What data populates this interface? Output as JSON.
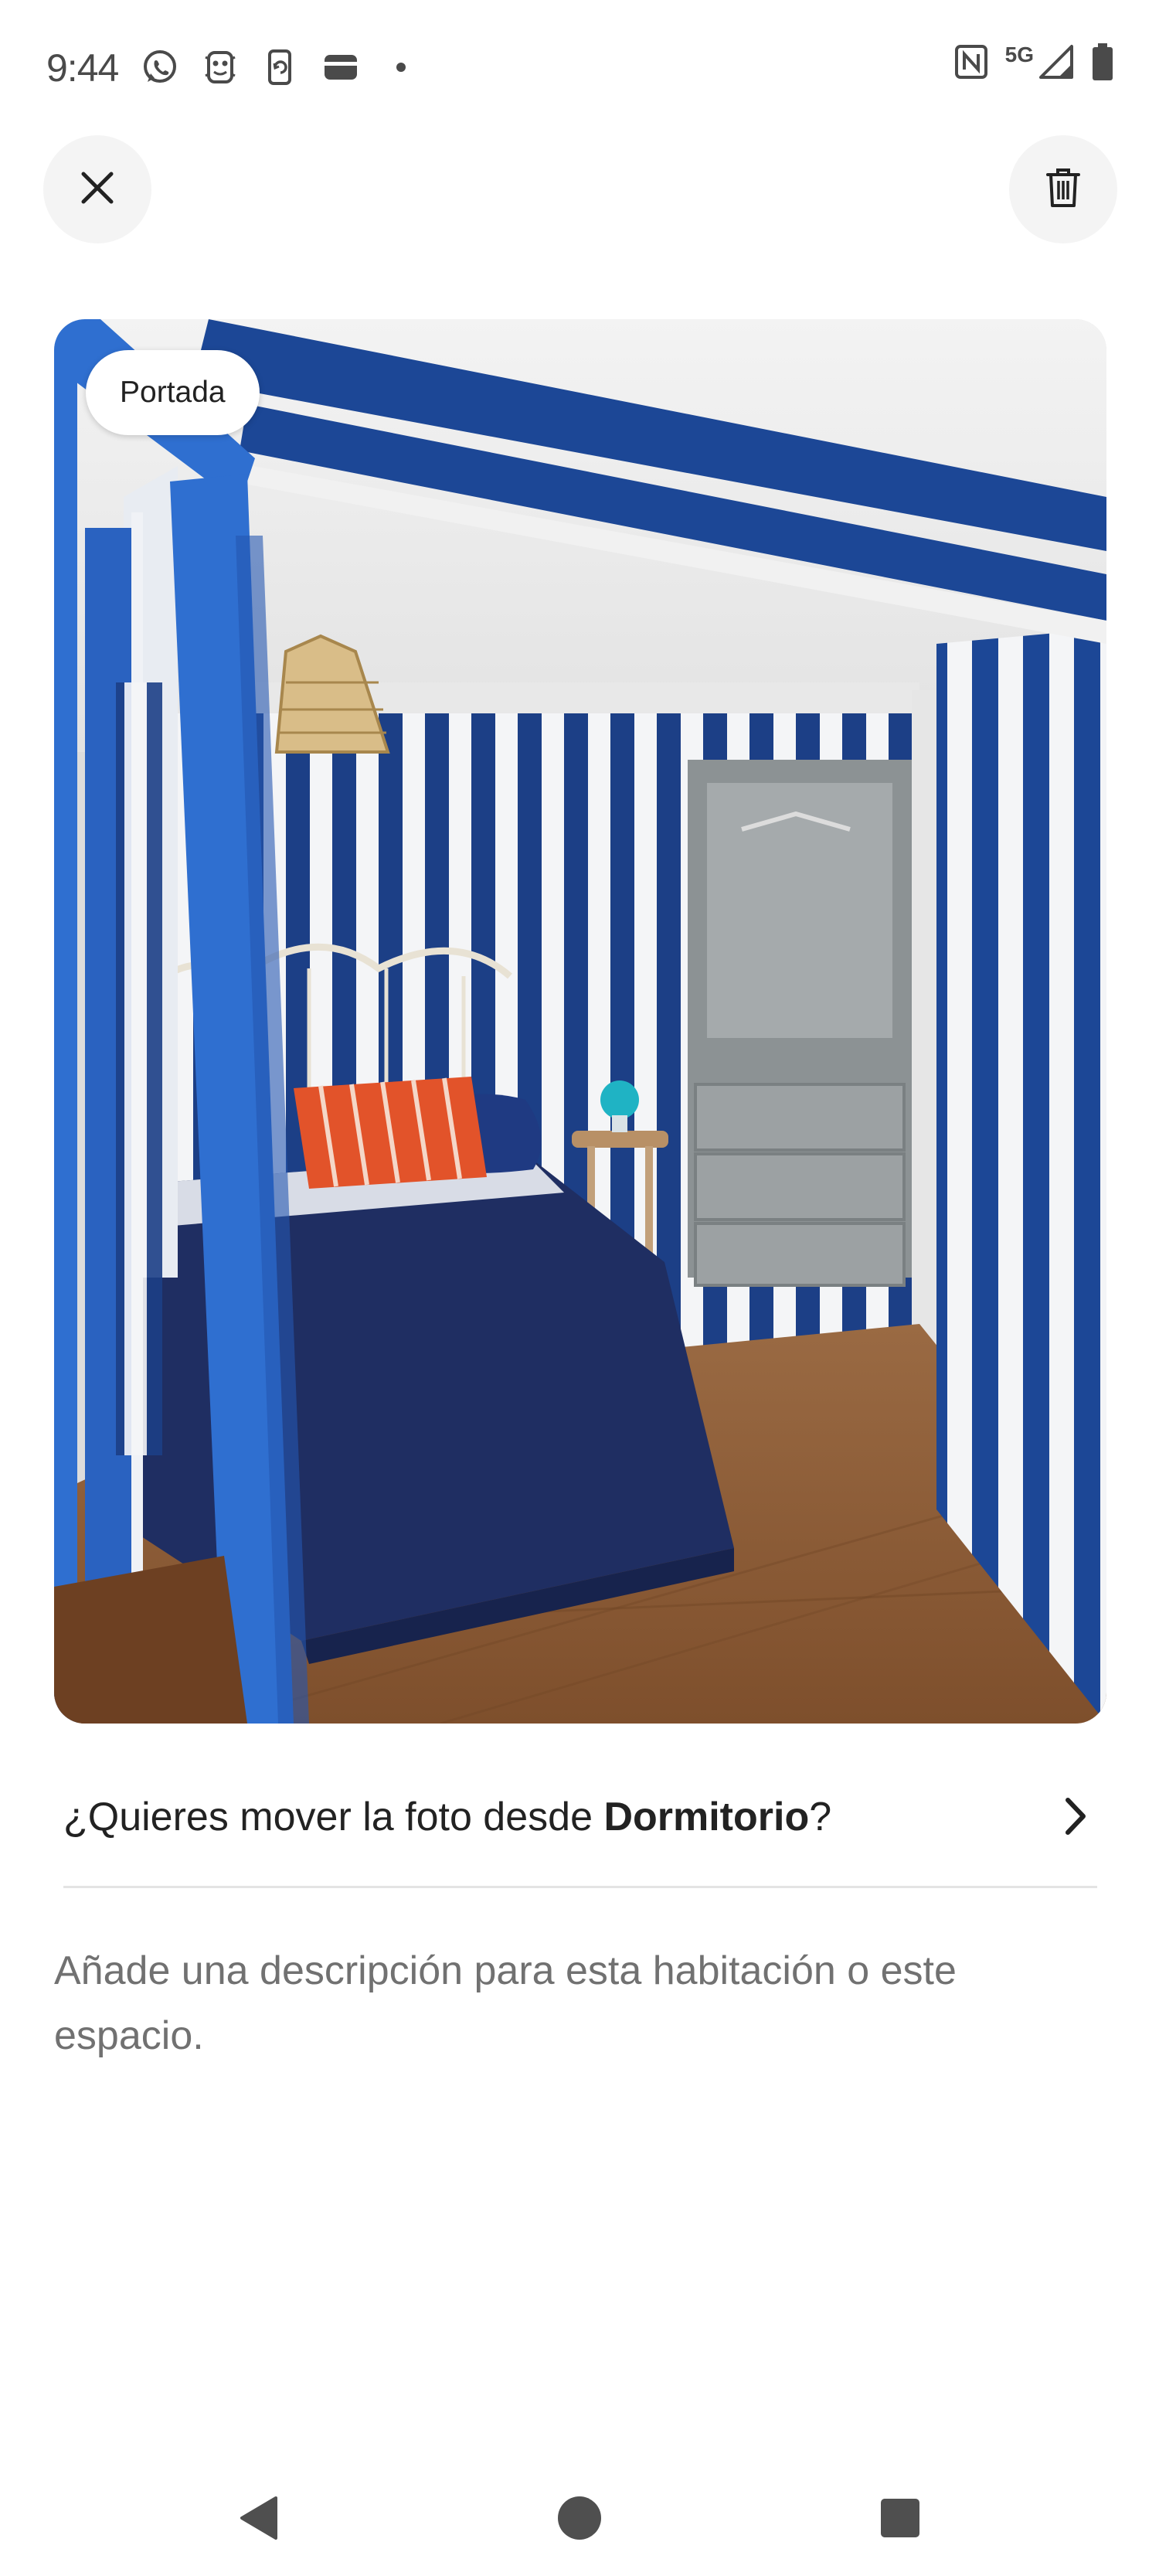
{
  "status_bar": {
    "time": "9:44",
    "network": "5G",
    "left_icons": [
      "whatsapp-icon",
      "app-notification-icon",
      "phone-sync-icon",
      "wallet-icon",
      "more-dot-icon"
    ],
    "right_icons": [
      "nfc-icon",
      "signal-icon",
      "battery-icon"
    ]
  },
  "toolbar": {
    "close_icon": "close-icon",
    "delete_icon": "trash-icon"
  },
  "photo": {
    "badge": "Portada",
    "description": "bedroom with blue and white striped walls, navy bedspread, orange striped pillow, grey wardrobe"
  },
  "move_photo": {
    "prefix": "¿Quieres mover la foto desde ",
    "room": "Dormitorio",
    "suffix": "?",
    "chevron_icon": "chevron-right-icon"
  },
  "description_field": {
    "placeholder": "Añade una descripción para esta habitación o este espacio."
  },
  "nav_bar": {
    "icons": [
      "back-icon",
      "home-icon",
      "recents-icon"
    ]
  },
  "colors": {
    "stripe_blue": "#1b4a9e",
    "frame_blue": "#2f6fd0",
    "bedspread": "#1f2f63",
    "pillow": "#e0502a",
    "floor": "#8a5a35",
    "wardrobe": "#8e9496",
    "text_primary": "#222222",
    "text_secondary": "#717171"
  }
}
